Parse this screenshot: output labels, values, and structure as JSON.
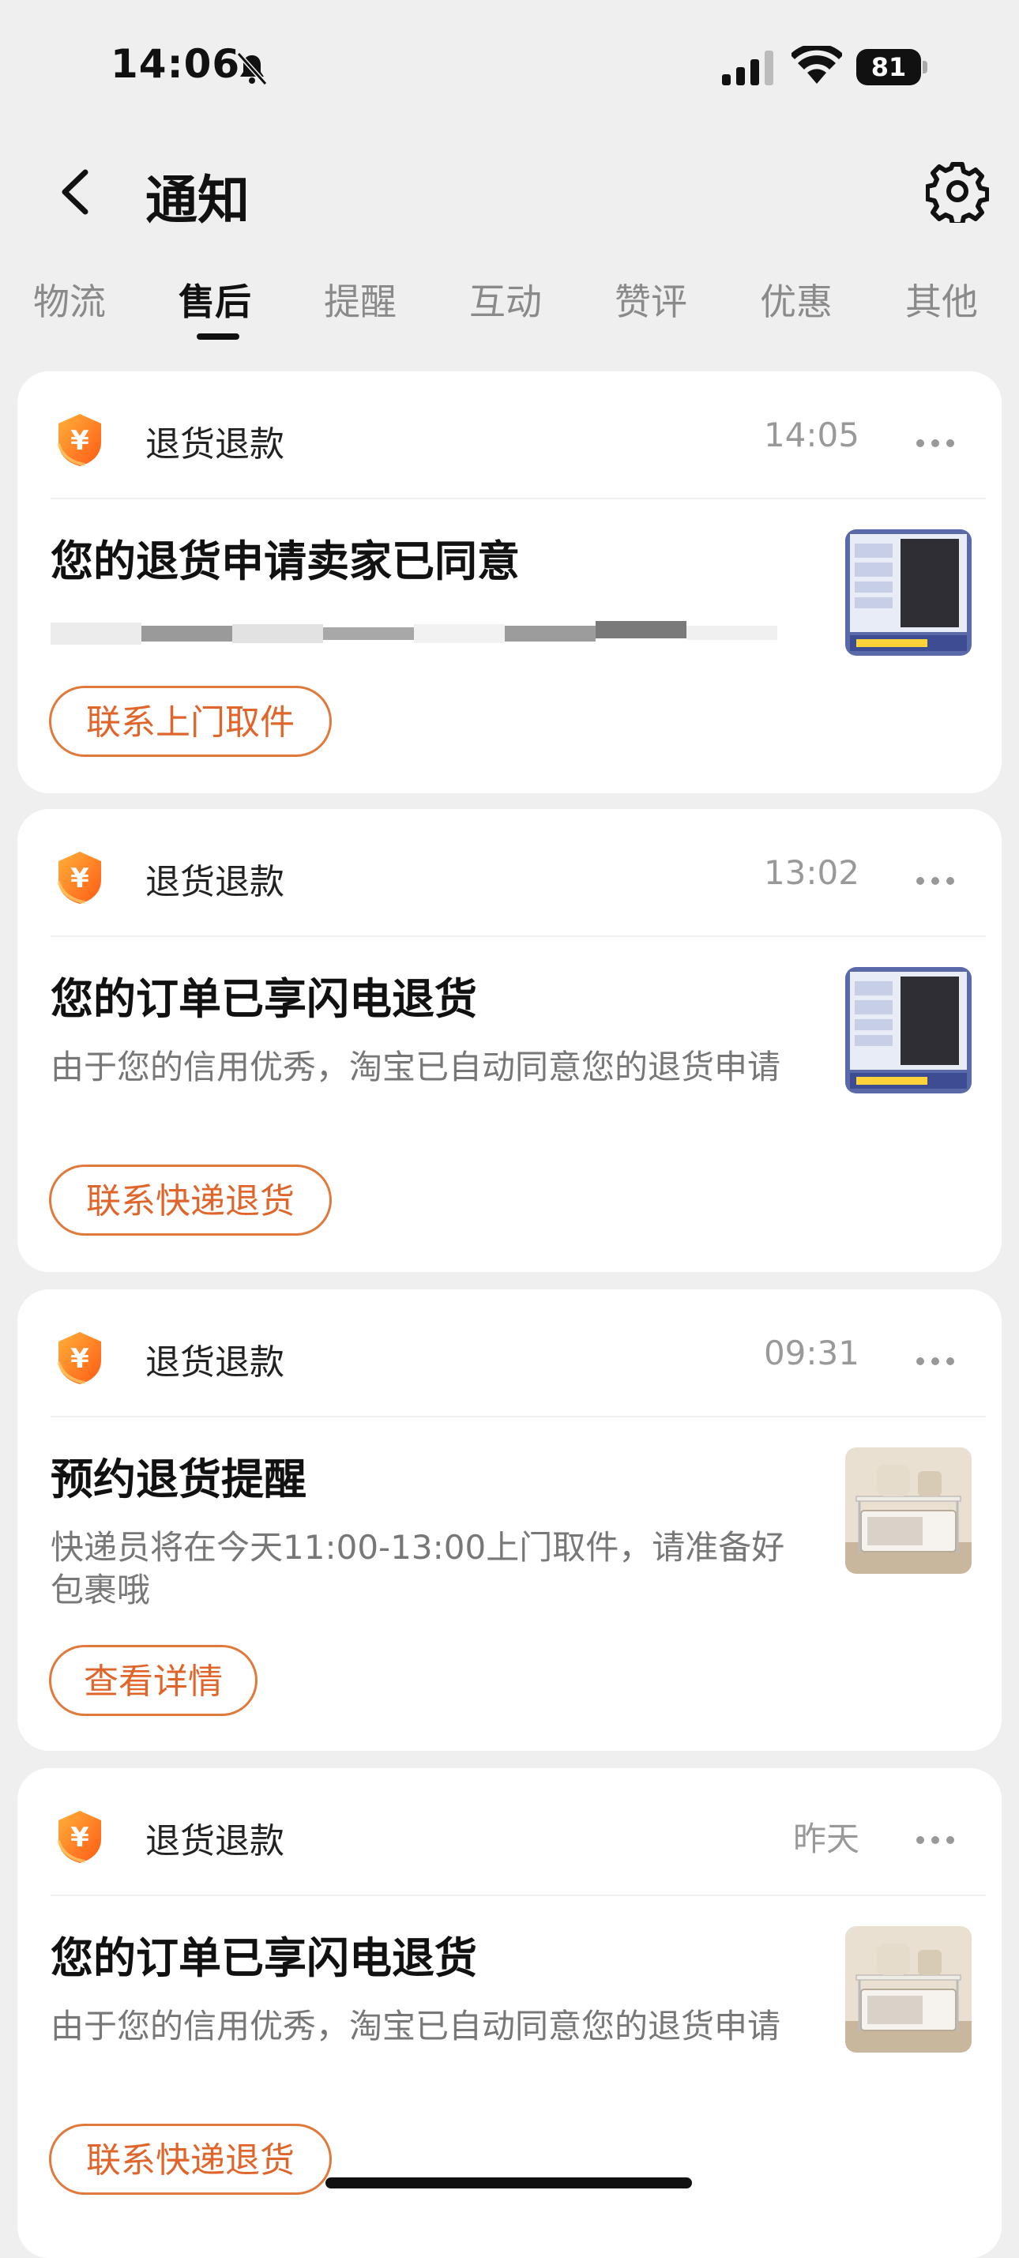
{
  "status_bar": {
    "time": "14:06",
    "battery": "81"
  },
  "header": {
    "title": "通知"
  },
  "tabs": [
    "物流",
    "售后",
    "提醒",
    "互动",
    "赞评",
    "优惠",
    "其他"
  ],
  "active_tab": "售后",
  "colors": {
    "accent": "#e0652a",
    "background": "#efefef",
    "coin": "#ff7a1a"
  },
  "cards": [
    {
      "category": "退货退款",
      "time": "14:05",
      "title": "您的退货申请卖家已同意",
      "description": "",
      "action": "联系上门取件",
      "thumbnail": "dark-panel-product-icon"
    },
    {
      "category": "退货退款",
      "time": "13:02",
      "title": "您的订单已享闪电退货",
      "description": "由于您的信用优秀，淘宝已自动同意您的退货申请",
      "action": "联系快递退货",
      "thumbnail": "dark-panel-product-icon"
    },
    {
      "category": "退货退款",
      "time": "09:31",
      "title": "预约退货提醒",
      "description": "快递员将在今天11:00-13:00上门取件，请准备好包裹哦",
      "action": "查看详情",
      "thumbnail": "microwave-rack-product-icon"
    },
    {
      "category": "退货退款",
      "time": "昨天",
      "title": "您的订单已享闪电退货",
      "description": "由于您的信用优秀，淘宝已自动同意您的退货申请",
      "action": "联系快递退货",
      "thumbnail": "microwave-rack-product-icon"
    }
  ]
}
